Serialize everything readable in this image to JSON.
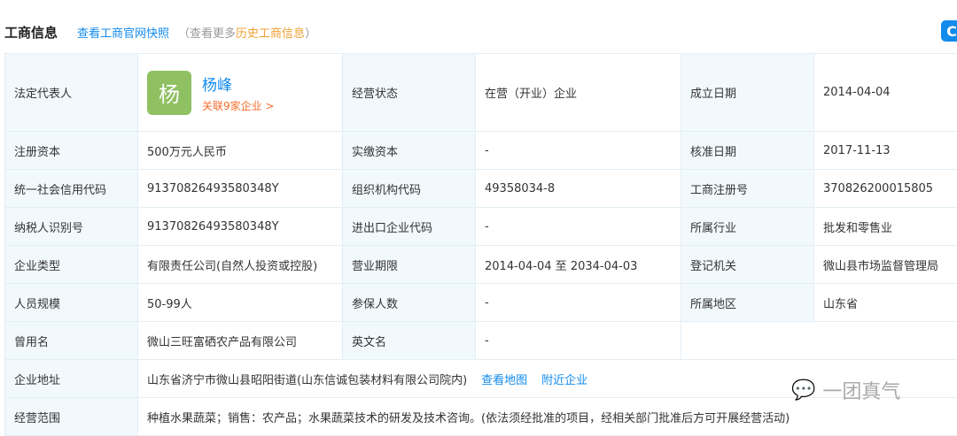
{
  "header": {
    "title": "工商信息",
    "snapshot_link": "查看工商官网快照",
    "hint_prefix": "（查看更多",
    "history_link": "历史工商信息",
    "hint_suffix": "）"
  },
  "logo_glyph": "C",
  "person": {
    "avatar": "杨",
    "name": "杨峰",
    "related": "关联9家企业 >"
  },
  "rows": [
    [
      {
        "l": "法定代表人"
      },
      {
        "l": "经营状态",
        "v": "在营（开业）企业"
      },
      {
        "l": "成立日期",
        "v": "2014-04-04"
      }
    ],
    [
      {
        "l": "注册资本",
        "v": "500万元人民币"
      },
      {
        "l": "实缴资本",
        "v": "-"
      },
      {
        "l": "核准日期",
        "v": "2017-11-13"
      }
    ],
    [
      {
        "l": "统一社会信用代码",
        "v": "91370826493580348Y"
      },
      {
        "l": "组织机构代码",
        "v": "49358034-8"
      },
      {
        "l": "工商注册号",
        "v": "370826200015805"
      }
    ],
    [
      {
        "l": "纳税人识别号",
        "v": "91370826493580348Y"
      },
      {
        "l": "进出口企业代码",
        "v": "-"
      },
      {
        "l": "所属行业",
        "v": "批发和零售业"
      }
    ],
    [
      {
        "l": "企业类型",
        "v": "有限责任公司(自然人投资或控股)"
      },
      {
        "l": "营业期限",
        "v": "2014-04-04 至 2034-04-03"
      },
      {
        "l": "登记机关",
        "v": "微山县市场监督管理局"
      }
    ],
    [
      {
        "l": "人员规模",
        "v": "50-99人"
      },
      {
        "l": "参保人数",
        "v": "-"
      },
      {
        "l": "所属地区",
        "v": "山东省"
      }
    ],
    [
      {
        "l": "曾用名",
        "v": "微山三旺富硒农产品有限公司"
      },
      {
        "l": "英文名",
        "v": "-"
      }
    ]
  ],
  "address": {
    "label": "企业地址",
    "value": "山东省济宁市微山县昭阳街道(山东信诚包装材料有限公司院内)",
    "map_link": "查看地图",
    "nearby_link": "附近企业"
  },
  "scope": {
    "label": "经营范围",
    "value": "种植水果蔬菜；销售：农产品；水果蔬菜技术的研发及技术咨询。(依法须经批准的项目，经相关部门批准后方可开展经营活动)"
  },
  "watermark": {
    "text": "一团真气"
  }
}
